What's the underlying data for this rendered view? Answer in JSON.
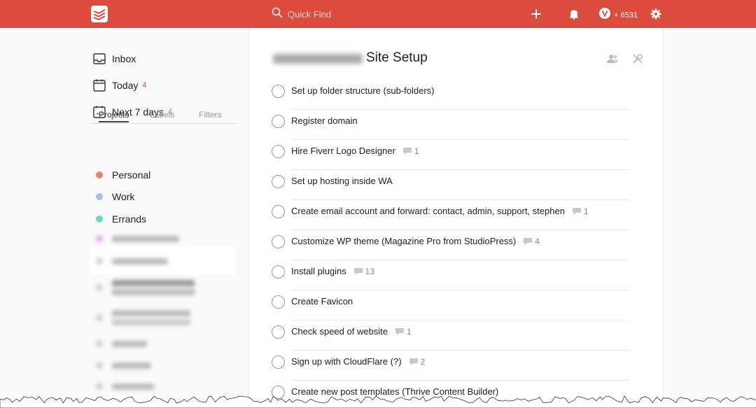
{
  "colors": {
    "topbar": "#db4c3f",
    "today": "#db4c3f",
    "personal": "#f08070",
    "work": "#a8c1e8",
    "errands": "#6fd9c3"
  },
  "topbar": {
    "search_placeholder": "Quick Find",
    "karma": "6531",
    "icons": [
      "todoist-logo-icon",
      "search-icon",
      "add-icon",
      "bell-icon",
      "karma-icon",
      "gear-icon"
    ]
  },
  "sidebar": {
    "nav": [
      {
        "label": "Inbox",
        "count": ""
      },
      {
        "label": "Today",
        "count": "4"
      },
      {
        "label": "Next 7 days",
        "count": "4"
      }
    ],
    "tabs": [
      "Projects",
      "Labels",
      "Filters"
    ],
    "projects": [
      {
        "label": "Personal"
      },
      {
        "label": "Work"
      },
      {
        "label": "Errands"
      }
    ]
  },
  "main": {
    "title": "Site Setup",
    "tasks": [
      {
        "label": "Set up folder structure (sub-folders)",
        "comments": ""
      },
      {
        "label": "Register domain",
        "comments": ""
      },
      {
        "label": "Hire Fiverr Logo Designer",
        "comments": "1"
      },
      {
        "label": "Set up hosting inside WA",
        "comments": ""
      },
      {
        "label": "Create email account and forward: contact, admin, support, stephen",
        "comments": "1"
      },
      {
        "label": "Customize WP theme (Magazine Pro from StudioPress)",
        "comments": "4"
      },
      {
        "label": "Install plugins",
        "comments": "13"
      },
      {
        "label": "Create Favicon",
        "comments": ""
      },
      {
        "label": "Check speed of website",
        "comments": "1"
      },
      {
        "label": "Sign up with CloudFlare (?)",
        "comments": "2"
      },
      {
        "label": "Create new post templates (Thrive Content Builder)",
        "comments": ""
      }
    ]
  }
}
